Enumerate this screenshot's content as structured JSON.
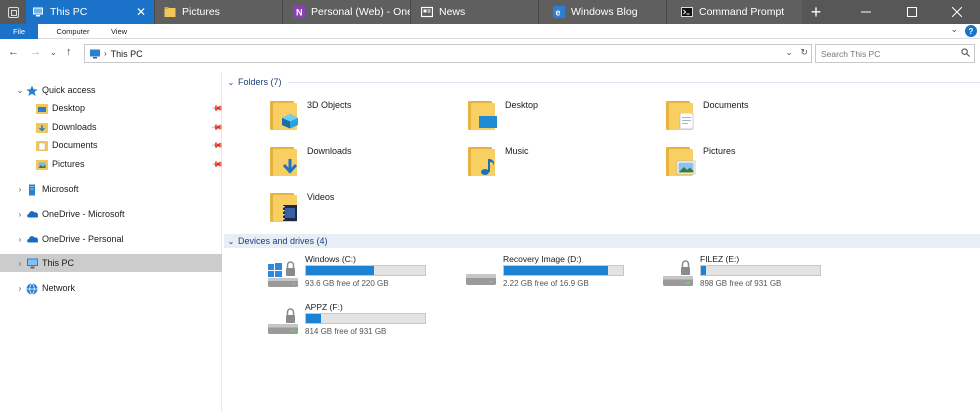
{
  "tabs": [
    {
      "label": "This PC",
      "icon": "this-pc-icon",
      "active": true
    },
    {
      "label": "Pictures",
      "icon": "folder-icon",
      "active": false
    },
    {
      "label": "Personal (Web) - One",
      "icon": "onenote-icon",
      "active": false
    },
    {
      "label": "News",
      "icon": "news-icon",
      "active": false
    },
    {
      "label": "Windows Blog",
      "icon": "edge-icon",
      "active": false
    },
    {
      "label": "Command Prompt",
      "icon": "cmd-icon",
      "active": false
    }
  ],
  "ribbon": {
    "file": "File",
    "computer": "Computer",
    "view": "View"
  },
  "address": {
    "path": "This PC",
    "search_placeholder": "Search This PC"
  },
  "sidebar": {
    "quick_access": "Quick access",
    "quick_items": [
      "Desktop",
      "Downloads",
      "Documents",
      "Pictures"
    ],
    "items": [
      "Microsoft",
      "OneDrive - Microsoft",
      "OneDrive - Personal",
      "This PC",
      "Network"
    ]
  },
  "folders": {
    "header": "Folders (7)",
    "items": [
      "3D Objects",
      "Desktop",
      "Documents",
      "Downloads",
      "Music",
      "Pictures",
      "Videos"
    ]
  },
  "drives": {
    "header": "Devices and drives (4)",
    "items": [
      {
        "name": "Windows (C:)",
        "free": "93.6 GB free of 220 GB",
        "used_fraction": 0.57
      },
      {
        "name": "Recovery Image (D:)",
        "free": "2.22 GB free of 16.9 GB",
        "used_fraction": 0.87
      },
      {
        "name": "FILEZ (E:)",
        "free": "898 GB free of 931 GB",
        "used_fraction": 0.04
      },
      {
        "name": "APPZ (F:)",
        "free": "814 GB free of 931 GB",
        "used_fraction": 0.13
      }
    ]
  },
  "colors": {
    "accent": "#1a73c8",
    "tabbar": "#575757",
    "folder": "#f8cf62",
    "drive_fill": "#1c82d4"
  }
}
